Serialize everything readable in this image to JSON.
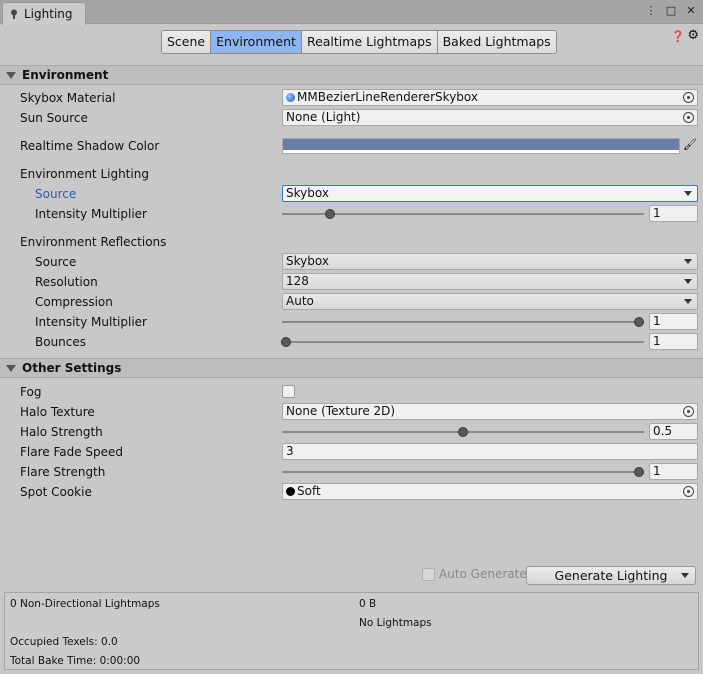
{
  "window": {
    "tab_title": "Lighting",
    "menu_icon": "vertical-ellipsis-icon",
    "maximize_icon": "maximize-icon",
    "close_icon": "close-icon"
  },
  "toolbar": {
    "tabs": [
      {
        "label": "Scene",
        "active": false
      },
      {
        "label": "Environment",
        "active": true
      },
      {
        "label": "Realtime Lightmaps",
        "active": false
      },
      {
        "label": "Baked Lightmaps",
        "active": false
      }
    ],
    "help_icon": "help-icon",
    "settings_icon": "gear-icon"
  },
  "environment": {
    "header": "Environment",
    "skybox_material": {
      "label": "Skybox Material",
      "value": "MMBezierLineRendererSkybox"
    },
    "sun_source": {
      "label": "Sun Source",
      "value": "None (Light)"
    },
    "realtime_shadow_color": {
      "label": "Realtime Shadow Color",
      "color": "#6c7ea8"
    },
    "lighting": {
      "header": "Environment Lighting",
      "source": {
        "label": "Source",
        "value": "Skybox"
      },
      "intensity": {
        "label": "Intensity Multiplier",
        "value": "1",
        "fraction": 0.13
      }
    },
    "reflections": {
      "header": "Environment Reflections",
      "source": {
        "label": "Source",
        "value": "Skybox"
      },
      "resolution": {
        "label": "Resolution",
        "value": "128"
      },
      "compression": {
        "label": "Compression",
        "value": "Auto"
      },
      "intensity": {
        "label": "Intensity Multiplier",
        "value": "1",
        "fraction": 1.0
      },
      "bounces": {
        "label": "Bounces",
        "value": "1",
        "fraction": 0.0
      }
    }
  },
  "other": {
    "header": "Other Settings",
    "fog": {
      "label": "Fog",
      "checked": false
    },
    "halo_texture": {
      "label": "Halo Texture",
      "value": "None (Texture 2D)"
    },
    "halo_strength": {
      "label": "Halo Strength",
      "value": "0.5",
      "fraction": 0.5
    },
    "flare_fade_speed": {
      "label": "Flare Fade Speed",
      "value": "3"
    },
    "flare_strength": {
      "label": "Flare Strength",
      "value": "1",
      "fraction": 1.0
    },
    "spot_cookie": {
      "label": "Spot Cookie",
      "value": "Soft"
    }
  },
  "footer": {
    "auto_generate": "Auto Generate",
    "generate_button": "Generate Lighting",
    "stats": {
      "non_directional": "0 Non-Directional Lightmaps",
      "size": "0 B",
      "no_lightmaps": "No Lightmaps",
      "occupied_texels": "Occupied Texels: 0.0",
      "total_bake_time": "Total Bake Time: 0:00:00"
    }
  }
}
